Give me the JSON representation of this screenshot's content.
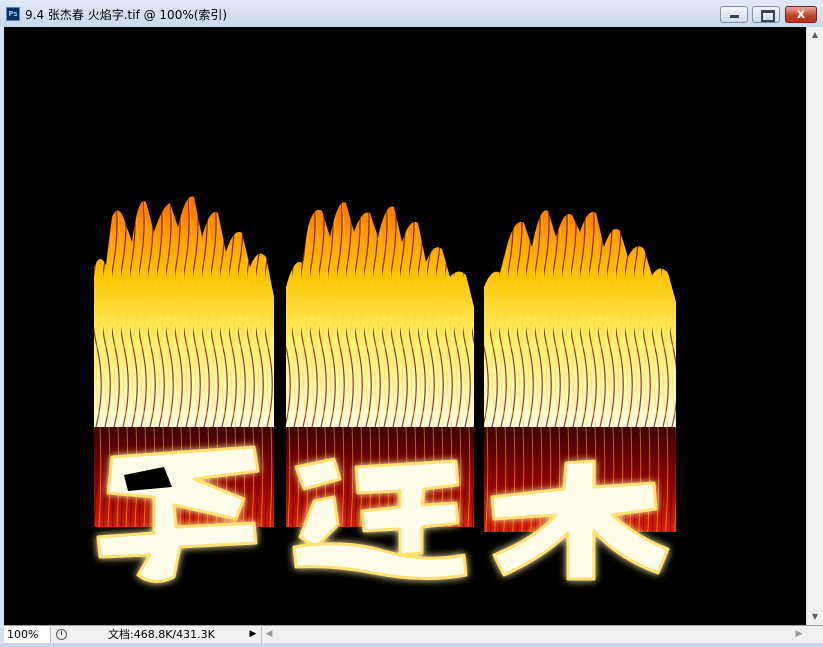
{
  "window": {
    "app_icon_text": "Ps",
    "title": "9.4 张杰春 火焰字.tif @ 100%(索引)"
  },
  "titlebar_buttons": {
    "close_glyph": "x"
  },
  "canvas": {
    "background": "#000000",
    "flame_text": "李连杰"
  },
  "status": {
    "zoom": "100%",
    "doc_info": "文档:468.8K/431.3K",
    "menu_arrow": "▶"
  },
  "scroll": {
    "up": "▲",
    "down": "▼",
    "left": "◀",
    "right": "▶"
  },
  "icons": [
    "photoshop-app-icon",
    "minimize-icon",
    "maximize-icon",
    "close-icon",
    "status-info-icon",
    "scroll-up-arrow-icon",
    "scroll-down-arrow-icon",
    "scroll-left-arrow-icon",
    "scroll-right-arrow-icon"
  ]
}
